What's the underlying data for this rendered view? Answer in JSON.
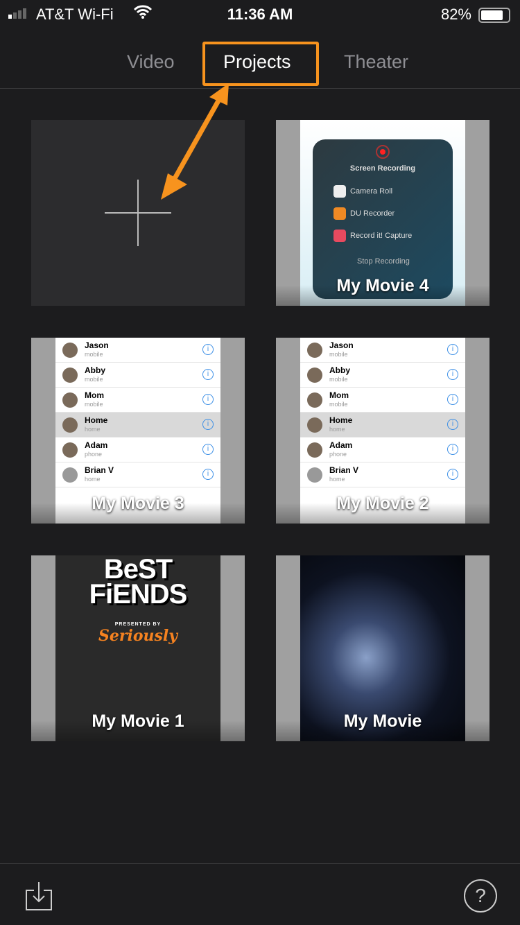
{
  "status": {
    "carrier": "AT&T Wi-Fi",
    "time": "11:36 AM",
    "battery": "82%",
    "battery_level": 0.82
  },
  "tabs": [
    {
      "label": "Video"
    },
    {
      "label": "Projects",
      "active": true
    },
    {
      "label": "Theater"
    }
  ],
  "accent": "#f7931e",
  "projects": [
    {
      "title": "My Movie 4",
      "thumb": {
        "header": "Screen Recording",
        "items": [
          "Camera Roll",
          "DU Recorder",
          "Record it! Capture"
        ],
        "footer": "Stop Recording"
      }
    },
    {
      "title": "My Movie 3"
    },
    {
      "title": "My Movie 2"
    },
    {
      "title": "My Movie 1",
      "thumb": {
        "logo": "BeST FiENDS",
        "presented": "PRESENTED BY",
        "brand": "Seriously"
      }
    },
    {
      "title": "My Movie"
    }
  ],
  "contacts": [
    {
      "name": "Jason",
      "type": "mobile"
    },
    {
      "name": "Abby",
      "type": "mobile"
    },
    {
      "name": "Mom",
      "type": "mobile"
    },
    {
      "name": "Home",
      "type": "home"
    },
    {
      "name": "Adam",
      "type": "phone"
    },
    {
      "name": "Brian V",
      "type": "home"
    }
  ],
  "help_label": "?"
}
